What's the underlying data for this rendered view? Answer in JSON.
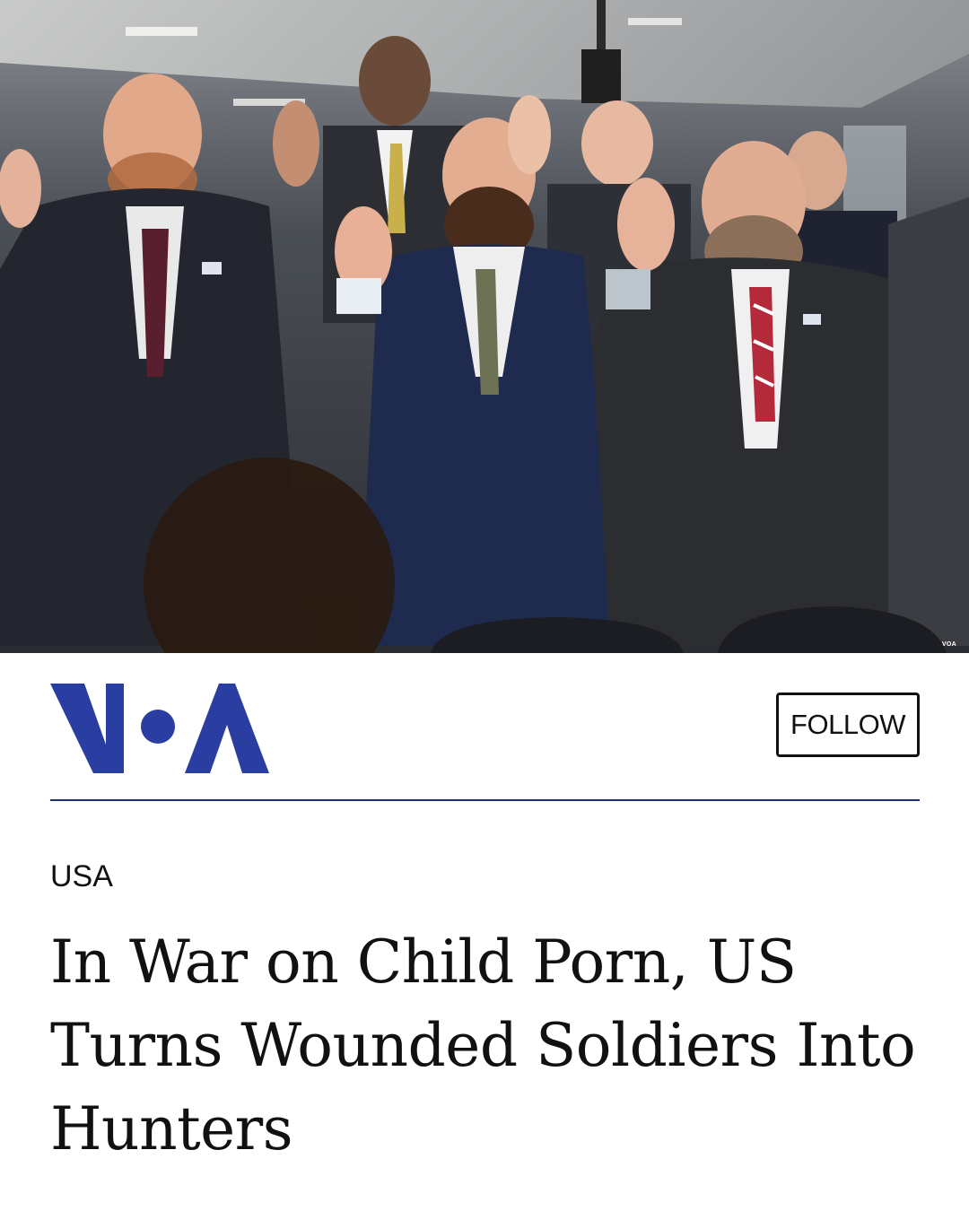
{
  "hero_image": {
    "description_icon": "news-photo",
    "credit": "VOA"
  },
  "brand": {
    "logo_text": "VOA",
    "logo_color": "#2a3ea1",
    "follow_label": "FOLLOW"
  },
  "article": {
    "section": "USA",
    "headline": "In War on Child Porn, US Turns Wounded Soldiers Into Hunters"
  },
  "colors": {
    "divider": "#1e2f7a",
    "text": "#111111",
    "background": "#ffffff"
  }
}
